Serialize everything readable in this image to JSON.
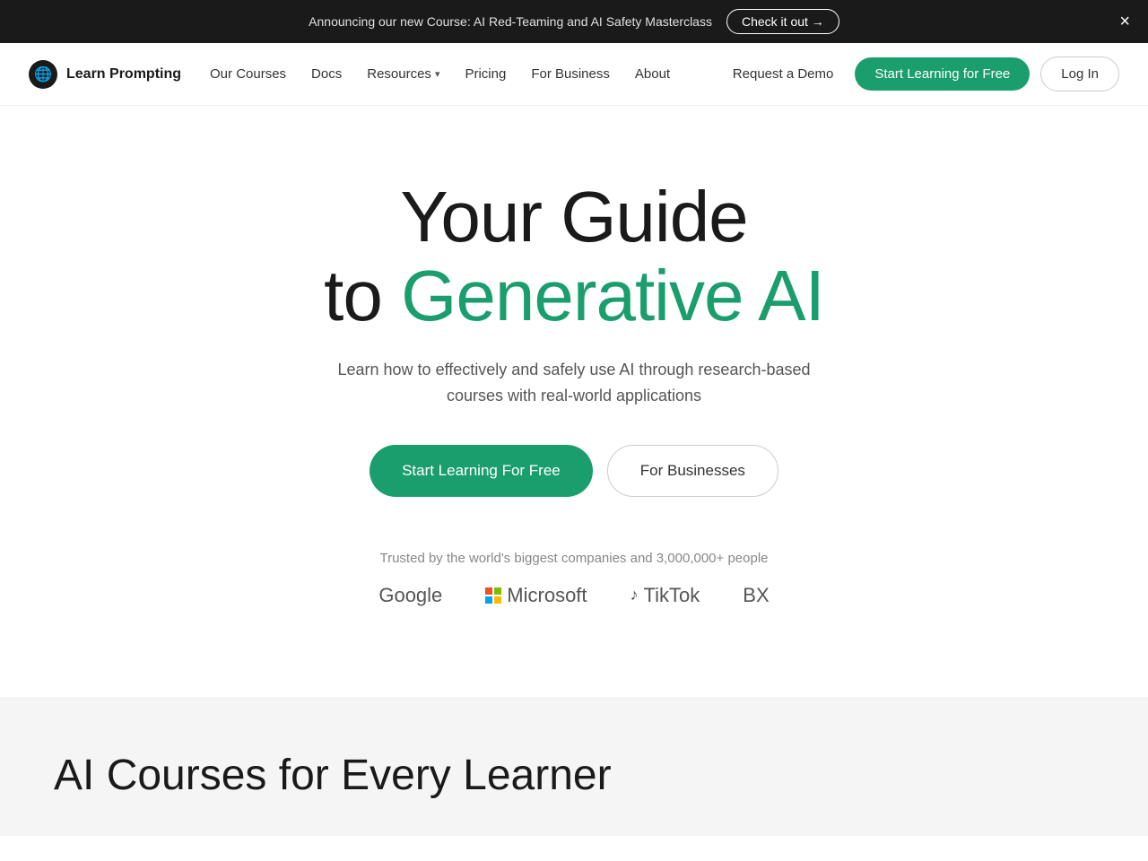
{
  "banner": {
    "announcement": "Announcing our new Course: AI Red-Teaming and AI Safety Masterclass",
    "cta_label": "Check it out →",
    "close_label": "×"
  },
  "navbar": {
    "logo_text": "Learn Prompting",
    "links": [
      {
        "label": "Our Courses",
        "has_dropdown": false
      },
      {
        "label": "Docs",
        "has_dropdown": false
      },
      {
        "label": "Resources",
        "has_dropdown": true
      },
      {
        "label": "Pricing",
        "has_dropdown": false
      },
      {
        "label": "For Business",
        "has_dropdown": false
      },
      {
        "label": "About",
        "has_dropdown": false
      }
    ],
    "request_demo_label": "Request a Demo",
    "start_learning_label": "Start Learning for Free",
    "login_label": "Log In"
  },
  "hero": {
    "heading_line1": "Your Guide",
    "heading_line2_plain": "to ",
    "heading_line2_colored": "Generative AI",
    "subtext": "Learn how to effectively and safely use AI through research-based courses with real-world applications",
    "cta_primary": "Start Learning For Free",
    "cta_secondary": "For Businesses"
  },
  "trusted": {
    "text": "Trusted by the world's biggest companies and 3,000,000+ people",
    "logos": [
      {
        "name": "Google",
        "type": "text"
      },
      {
        "name": "Microsoft",
        "type": "grid"
      },
      {
        "name": "TikTok",
        "type": "tiktok"
      },
      {
        "name": "BX",
        "type": "text"
      }
    ]
  },
  "ai_courses": {
    "heading": "AI Courses for Every Learner"
  }
}
